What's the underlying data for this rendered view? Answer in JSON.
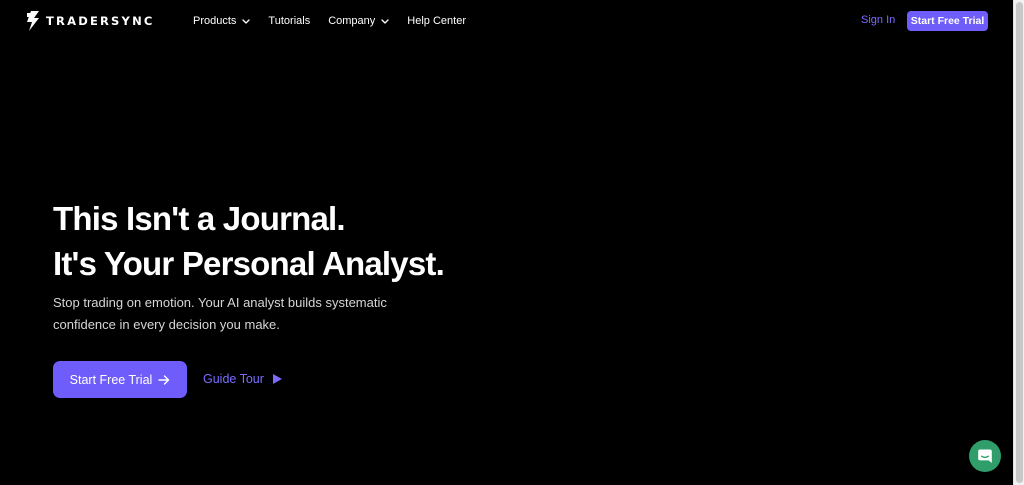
{
  "brand": {
    "name": "TRADERSYNC",
    "logo_icon": "tradersync-bolt-logo"
  },
  "nav": {
    "items": [
      {
        "label": "Products",
        "dropdown": true
      },
      {
        "label": "Tutorials",
        "dropdown": false
      },
      {
        "label": "Company",
        "dropdown": true
      },
      {
        "label": "Help Center",
        "dropdown": false
      }
    ],
    "sign_in": "Sign In",
    "cta": "Start Free Trial"
  },
  "hero": {
    "title_line1": "This Isn't a Journal.",
    "title_line2": "It's Your Personal Analyst.",
    "subtitle": "Stop trading on emotion. Your AI analyst builds systematic confidence in every decision you make.",
    "cta": "Start Free Trial",
    "cta_icon": "arrow-right-icon",
    "guide": "Guide Tour",
    "guide_icon": "play-icon"
  },
  "chat_widget": {
    "icon": "chat-bubble-icon"
  },
  "colors": {
    "background": "#000000",
    "accent": "#6e5dfa",
    "link": "#7b6bff",
    "chat": "#2f9e6b"
  }
}
